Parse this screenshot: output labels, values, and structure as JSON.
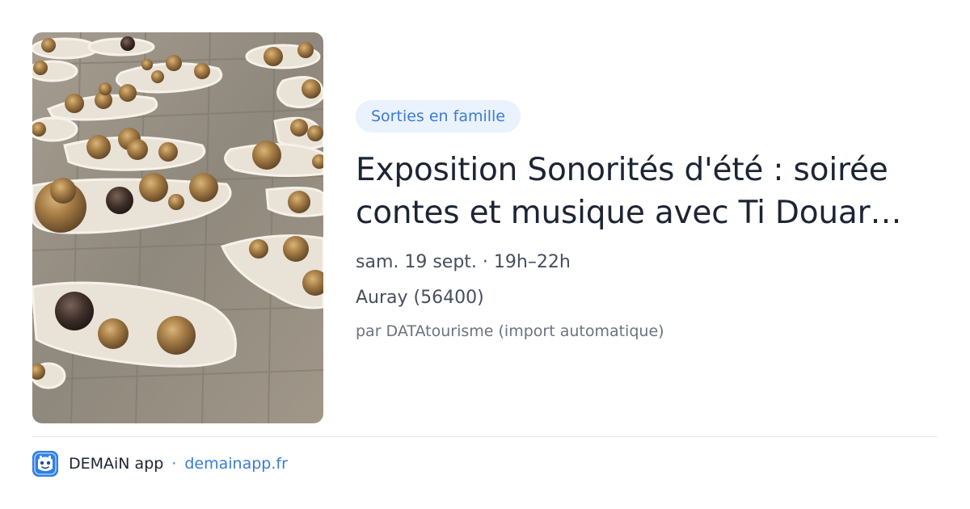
{
  "event": {
    "category": "Sorties en famille",
    "title": "Exposition Sonorités d'été : soirée contes et musique avec Ti Douar…",
    "datetime": "sam. 19 sept. · 19h–22h",
    "location": "Auray (56400)",
    "source": "par DATAtourisme (import automatique)"
  },
  "footer": {
    "app_name": "DEMAiN app",
    "separator": "·",
    "domain": "demainapp.fr"
  },
  "colors": {
    "accent": "#3a7bd5",
    "chip_bg": "#eaf2fd",
    "app_icon": "#2f7fe6"
  },
  "icons": {
    "app": "demain-app-icon"
  }
}
